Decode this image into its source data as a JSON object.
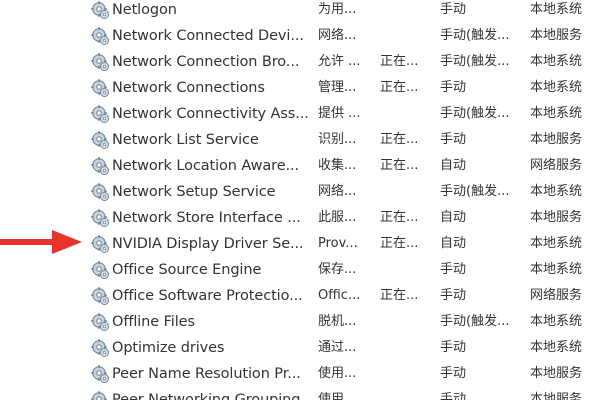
{
  "services": [
    {
      "name": "Netlogon",
      "description": "为用...",
      "status": "",
      "startup": "手动",
      "logon": "本地系统"
    },
    {
      "name": "Network Connected Devi...",
      "description": "网络...",
      "status": "",
      "startup": "手动(触发...",
      "logon": "本地服务"
    },
    {
      "name": "Network Connection Bro...",
      "description": "允许 ...",
      "status": "正在...",
      "startup": "手动(触发...",
      "logon": "本地系统"
    },
    {
      "name": "Network Connections",
      "description": "管理...",
      "status": "正在...",
      "startup": "手动",
      "logon": "本地系统"
    },
    {
      "name": "Network Connectivity Ass...",
      "description": "提供 ...",
      "status": "",
      "startup": "手动(触发...",
      "logon": "本地系统"
    },
    {
      "name": "Network List Service",
      "description": "识别...",
      "status": "正在...",
      "startup": "手动",
      "logon": "本地服务"
    },
    {
      "name": "Network Location Aware...",
      "description": "收集...",
      "status": "正在...",
      "startup": "自动",
      "logon": "网络服务"
    },
    {
      "name": "Network Setup Service",
      "description": "网络...",
      "status": "",
      "startup": "手动(触发...",
      "logon": "本地系统"
    },
    {
      "name": "Network Store Interface ...",
      "description": "此服...",
      "status": "正在...",
      "startup": "自动",
      "logon": "本地服务"
    },
    {
      "name": "NVIDIA Display Driver Se...",
      "description": "Prov...",
      "status": "正在...",
      "startup": "自动",
      "logon": "本地系统"
    },
    {
      "name": "Office  Source Engine",
      "description": "保存...",
      "status": "",
      "startup": "手动",
      "logon": "本地系统"
    },
    {
      "name": "Office Software Protectio...",
      "description": "Offic...",
      "status": "正在...",
      "startup": "手动",
      "logon": "网络服务"
    },
    {
      "name": "Offline Files",
      "description": "脱机...",
      "status": "",
      "startup": "手动(触发...",
      "logon": "本地系统"
    },
    {
      "name": "Optimize drives",
      "description": "通过...",
      "status": "",
      "startup": "手动",
      "logon": "本地系统"
    },
    {
      "name": "Peer Name Resolution Pr...",
      "description": "使用...",
      "status": "",
      "startup": "手动",
      "logon": "本地服务"
    },
    {
      "name": "Peer Networking Grouping",
      "description": "使用...",
      "status": "",
      "startup": "手动",
      "logon": "本地服务"
    }
  ],
  "highlighted_row_index": 9,
  "icon": "gear-service-icon",
  "annotation": {
    "icon": "red-arrow-icon",
    "color": "#e8322c"
  }
}
